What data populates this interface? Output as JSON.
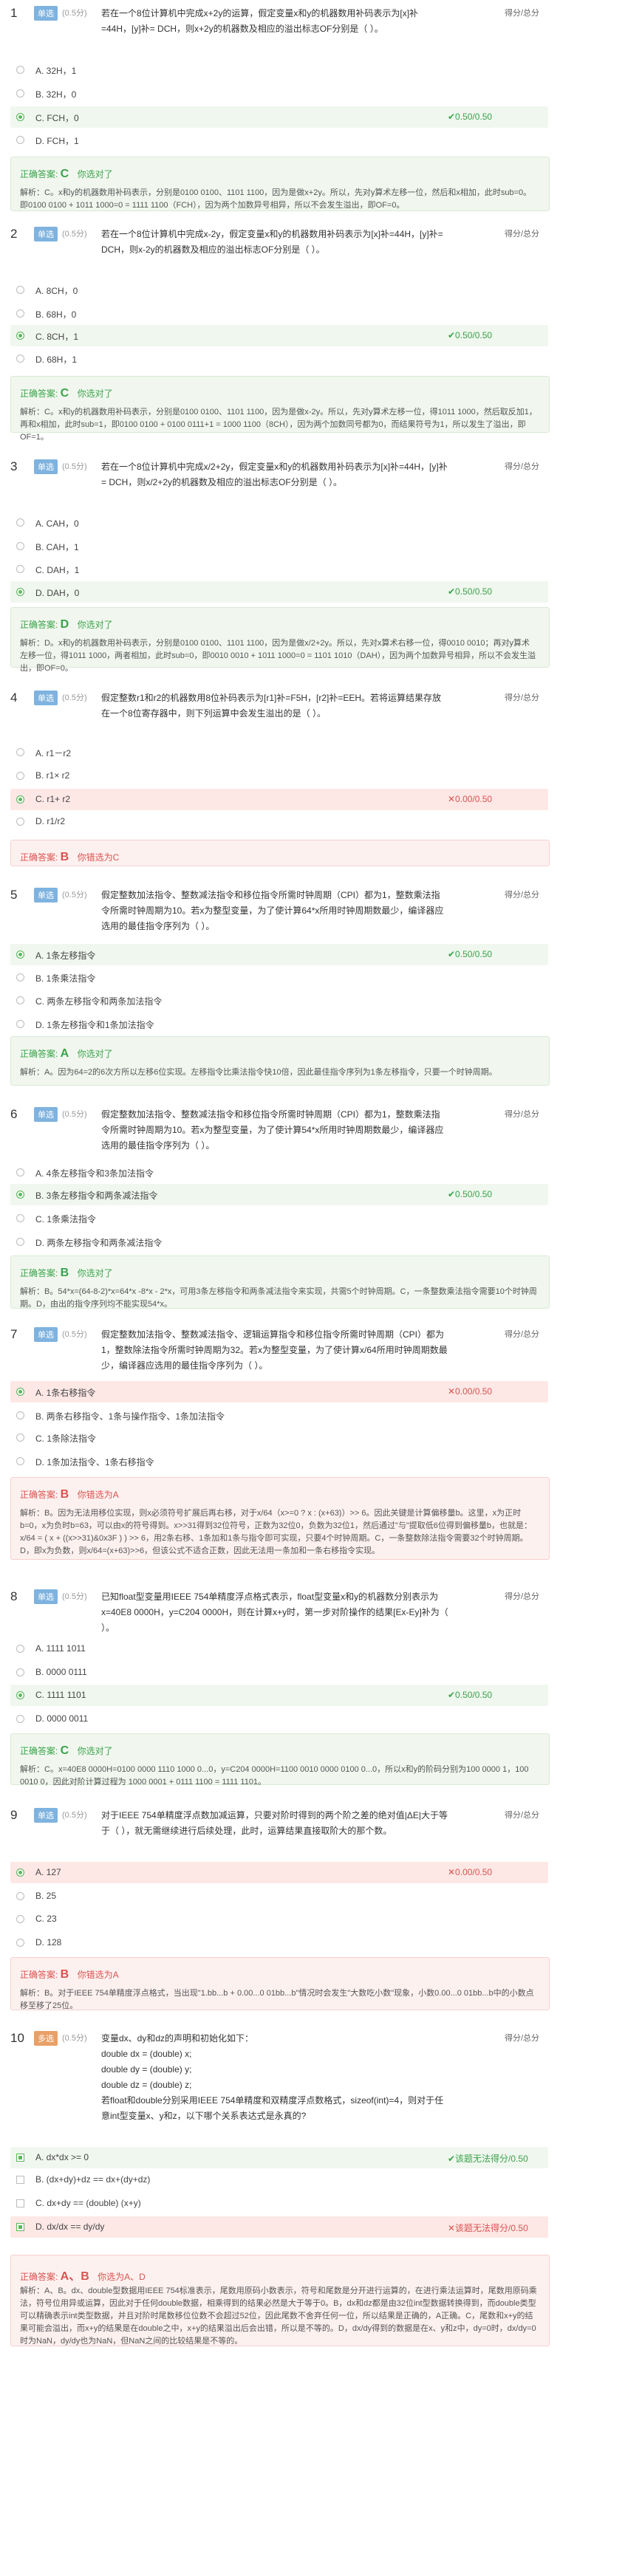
{
  "score_label": "得分/总分",
  "questions": [
    {
      "num": "1",
      "type": "单选",
      "score": "(0.5分)",
      "text": "若在一个8位计算机中完成x+2y的运算，假定变量x和y的机器数用补码表示为[x]补=44H，[y]补= DCH，则x+2y的机器数及相应的溢出标志OF分别是（   ）。",
      "options": [
        {
          "label": "A.  32H，1"
        },
        {
          "label": "B.  32H，0"
        },
        {
          "label": "C.  FCH，0",
          "status": "✔0.50/0.50"
        },
        {
          "label": "D.  FCH，1"
        }
      ],
      "answer_label": "正确答案:",
      "answer": "C",
      "result": "你选对了",
      "explain": "解析：C。x和y的机器数用补码表示，分别是0100 0100、1101 1100，因为是做x+2y。所以，先对y算术左移一位，然后和x相加，此时sub=0。即0100 0100 + 1011 1000=0 = 1111 1100（FCH），因为两个加数异号相异，所以不会发生溢出，即OF=0。"
    },
    {
      "num": "2",
      "type": "单选",
      "score": "(0.5分)",
      "text": "若在一个8位计算机中完成x-2y，假定变量x和y的机器数用补码表示为[x]补=44H，[y]补= DCH，则x-2y的机器数及相应的溢出标志OF分别是（   ）。",
      "options": [
        {
          "label": "A.  8CH，0"
        },
        {
          "label": "B.  68H，0"
        },
        {
          "label": "C.  8CH，1",
          "status": "✔0.50/0.50"
        },
        {
          "label": "D.  68H，1"
        }
      ],
      "answer_label": "正确答案:",
      "answer": "C",
      "result": "你选对了",
      "explain": "解析：C。x和y的机器数用补码表示，分别是0100 0100、1101 1100，因为是做x-2y。所以，先对y算术左移一位，得1011 1000，然后取反加1，再和x相加，此时sub=1，即0100 0100 + 0100 0111+1 = 1000 1100（8CH），因为两个加数同号都为0，而结果符号为1，所以发生了溢出，即OF=1。"
    },
    {
      "num": "3",
      "type": "单选",
      "score": "(0.5分)",
      "text": "若在一个8位计算机中完成x/2+2y，假定变量x和y的机器数用补码表示为[x]补=44H，[y]补= DCH，则x/2+2y的机器数及相应的溢出标志OF分别是（   ）。",
      "options": [
        {
          "label": "A.  CAH，0"
        },
        {
          "label": "B.  CAH，1"
        },
        {
          "label": "C.  DAH，1"
        },
        {
          "label": "D.  DAH，0",
          "status": "✔0.50/0.50"
        }
      ],
      "answer_label": "正确答案:",
      "answer": "D",
      "result": "你选对了",
      "explain": "解析：D。x和y的机器数用补码表示，分别是0100 0100、1101 1100，因为是做x/2+2y。所以，先对x算术右移一位，得0010 0010；再对y算术左移一位，得1011 1000，两者相加，此时sub=0，即0010 0010 + 1011 1000=0 = 1101 1010（DAH），因为两个加数异号相异，所以不会发生溢出，即OF=0。"
    },
    {
      "num": "4",
      "type": "单选",
      "score": "(0.5分)",
      "text": "假定整数r1和r2的机器数用8位补码表示为[r1]补=F5H，[r2]补=EEH。若将运算结果存放在一个8位寄存器中，则下列运算中会发生溢出的是（   ）。",
      "options": [
        {
          "label": "A.  r1－r2"
        },
        {
          "label": "B.  r1× r2"
        },
        {
          "label": "C.  r1+ r2",
          "status": "✕0.00/0.50"
        },
        {
          "label": "D.  r1/r2"
        }
      ],
      "answer_label": "正确答案:",
      "answer": "B",
      "result": "你错选为C",
      "explain": ""
    },
    {
      "num": "5",
      "type": "单选",
      "score": "(0.5分)",
      "text": "假定整数加法指令、整数减法指令和移位指令所需时钟周期（CPI）都为1，整数乘法指令所需时钟周期为10。若x为整型变量，为了使计算64*x所用时钟周期数最少，编译器应选用的最佳指令序列为（   ）。",
      "options": [
        {
          "label": "A.  1条左移指令",
          "status": "✔0.50/0.50"
        },
        {
          "label": "B.  1条乘法指令"
        },
        {
          "label": "C.  两条左移指令和两条加法指令"
        },
        {
          "label": "D.  1条左移指令和1条加法指令"
        }
      ],
      "answer_label": "正确答案:",
      "answer": "A",
      "result": "你选对了",
      "explain": "解析：A。因为64=2的6次方所以左移6位实现。左移指令比乘法指令快10倍，因此最佳指令序列为1条左移指令，只要一个时钟周期。"
    },
    {
      "num": "6",
      "type": "单选",
      "score": "(0.5分)",
      "text": "假定整数加法指令、整数减法指令和移位指令所需时钟周期（CPI）都为1，整数乘法指令所需时钟周期为10。若x为整型变量，为了使计算54*x所用时钟周期数最少，编译器应选用的最佳指令序列为（   ）。",
      "options": [
        {
          "label": "A.  4条左移指令和3条加法指令"
        },
        {
          "label": "B.  3条左移指令和两条减法指令",
          "status": "✔0.50/0.50"
        },
        {
          "label": "C.  1条乘法指令"
        },
        {
          "label": "D.  两条左移指令和两条减法指令"
        }
      ],
      "answer_label": "正确答案:",
      "answer": "B",
      "result": "你选对了",
      "explain": "解析：B。54*x=(64-8-2)*x=64*x -8*x - 2*x，可用3条左移指令和两条减法指令来实现，共需5个时钟周期。C，一条整数乘法指令需要10个时钟周期。D，由出的指令序列均不能实现54*x。"
    },
    {
      "num": "7",
      "type": "单选",
      "score": "(0.5分)",
      "text": "假定整数加法指令、整数减法指令、逻辑运算指令和移位指令所需时钟周期（CPI）都为1，整数除法指令所需时钟周期为32。若x为整型变量，为了使计算x/64所用时钟周期数最少，编译器应选用的最佳指令序列为（   ）。",
      "options": [
        {
          "label": "A.  1条右移指令",
          "status": "✕0.00/0.50"
        },
        {
          "label": "B.  两条右移指令、1条与操作指令、1条加法指令"
        },
        {
          "label": "C.  1条除法指令"
        },
        {
          "label": "D.  1条加法指令、1条右移指令"
        }
      ],
      "answer_label": "正确答案:",
      "answer": "B",
      "result": "你错选为A",
      "explain": "解析：B。因为无法用移位实现，则x必须符号扩展后再右移，对于x/64（x>=0 ? x : (x+63)）>> 6。因此关键是计算偏移量b。这里，x为正时b=0，x为负时b=63，可以由x的符号得到。x>>31得到32位符号，正数为32位0，负数为32位1，然后通过\"与\"提取低6位得到偏移量b，也就是：x/64 = ( x + ((x>>31)&0x3F ) ) >> 6，用2条右移、1条加和1条与指令即可实现，只要4个时钟周期。C，一条整数除法指令需要32个时钟周期。D，即x为负数，则x/64=(x+63)>>6，但该公式不适合正数，因此无法用一条加和一条右移指令实现。"
    },
    {
      "num": "8",
      "type": "单选",
      "score": "(0.5分)",
      "text": "已知float型变量用IEEE 754单精度浮点格式表示，float型变量x和y的机器数分别表示为x=40E8 0000H，y=C204 0000H，则在计算x+y时，第一步对阶操作的结果[Ex-Ey]补为（   ）。",
      "options": [
        {
          "label": "A.  1111 1011"
        },
        {
          "label": "B.  0000 0111"
        },
        {
          "label": "C.  1111 1101",
          "status": "✔0.50/0.50"
        },
        {
          "label": "D.  0000 0011"
        }
      ],
      "answer_label": "正确答案:",
      "answer": "C",
      "result": "你选对了",
      "explain": "解析：C。x=40E8 0000H=0100 0000 1110 1000 0...0，y=C204 0000H=1100 0010 0000 0100 0...0，所以x和y的阶码分别为100 0000 1，100 0010 0，因此对阶计算过程为 1000 0001 + 0111 1100 = 1111 1101。"
    },
    {
      "num": "9",
      "type": "单选",
      "score": "(0.5分)",
      "text": "对于IEEE 754单精度浮点数加减运算，只要对阶时得到的两个阶之差的绝对值|ΔE|大于等于（   ），就无需继续进行后续处理，此时，运算结果直接取阶大的那个数。",
      "options": [
        {
          "label": "A.  127",
          "status": "✕0.00/0.50"
        },
        {
          "label": "B.  25"
        },
        {
          "label": "C.  23"
        },
        {
          "label": "D.  128"
        }
      ],
      "answer_label": "正确答案:",
      "answer": "B",
      "result": "你错选为A",
      "explain": "解析：B。对于IEEE 754单精度浮点格式，当出现\"1.bb...b + 0.00...0 01bb...b\"情况时会发生\"大数吃小数\"现象，小数0.00...0 01bb...b中的小数点移至移了25位。"
    },
    {
      "num": "10",
      "type": "多选",
      "score": "(0.5分)",
      "text": "变量dx、dy和dz的声明和初始化如下：\n        double dx = (double) x;\n        double dy = (double) y;\n        double dz = (double) z;\n若float和double分别采用IEEE 754单精度和双精度浮点数格式，sizeof(int)=4，则对于任意int型变量x、y和z，以下哪个关系表达式是永真的?",
      "options": [
        {
          "label": "A.  dx*dx >= 0",
          "status": "✔该题无法得分/0.50"
        },
        {
          "label": "B.  (dx+dy)+dz == dx+(dy+dz)"
        },
        {
          "label": "C.  dx+dy == (double) (x+y)"
        },
        {
          "label": "D.  dx/dx == dy/dy",
          "status": "✕该题无法得分/0.50"
        }
      ],
      "answer_label": "正确答案:",
      "answer": "A、B",
      "result": "你选为A、D",
      "explain": "解析：A、B。dx、double型数据用IEEE 754标准表示，尾数用原码小数表示，符号和尾数是分开进行运算的，在进行乘法运算时，尾数用原码乘法，符号位用异或运算，因此对于任何double数据，相乘得到的结果必然是大于等于0。B，dx和dz都是由32位int型数据转换得到，而double类型可以精确表示int类型数据，并且对阶时尾数移位位数不会超过52位，因此尾数不舍弃任何一位，所以结果是正确的，A正确。C，尾数和x+y的结果可能会溢出，而x+y的结果是在double之中，x+y的结果溢出后会出错，所以是不等的。D，dx/dy得到的数据是在x、y和z中，dy=0时，dx/dy=0时为NaN，dy/dy也为NaN，但NaN之间的比较结果是不等的。"
    }
  ]
}
